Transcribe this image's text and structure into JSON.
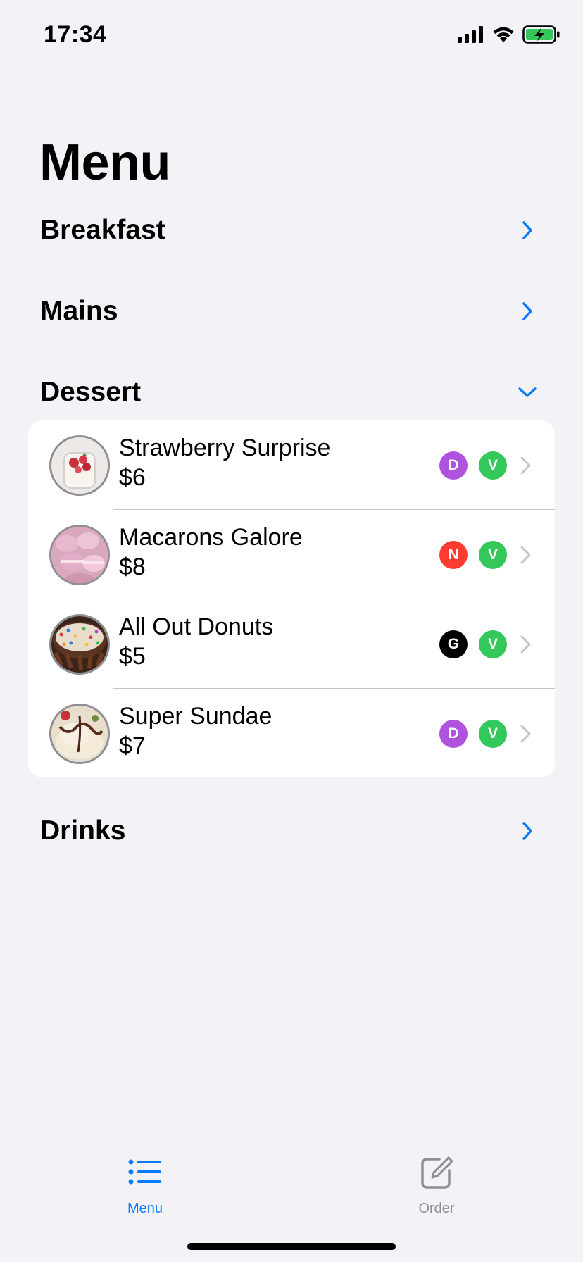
{
  "status_bar": {
    "time": "17:34"
  },
  "colors": {
    "accent": "#0A7AFF",
    "background": "#F2F2F7",
    "card": "#FFFFFF",
    "badge_D": "#AF52DE",
    "badge_V": "#34C759",
    "badge_N": "#FF3B30",
    "badge_G": "#000000",
    "inactive_tab": "#8E8E93"
  },
  "page": {
    "title": "Menu"
  },
  "sections": [
    {
      "label": "Breakfast",
      "state": "collapsed",
      "icon": "chevron-right-icon"
    },
    {
      "label": "Mains",
      "state": "collapsed",
      "icon": "chevron-right-icon"
    },
    {
      "label": "Dessert",
      "state": "expanded",
      "icon": "chevron-down-icon"
    },
    {
      "label": "Drinks",
      "state": "collapsed",
      "icon": "chevron-right-icon"
    }
  ],
  "dessert_items": [
    {
      "name": "Strawberry Surprise",
      "price": "$6",
      "badges": [
        "D",
        "V"
      ],
      "thumb": "strawberry-dessert-photo"
    },
    {
      "name": "Macarons Galore",
      "price": "$8",
      "badges": [
        "N",
        "V"
      ],
      "thumb": "macarons-photo"
    },
    {
      "name": "All Out Donuts",
      "price": "$5",
      "badges": [
        "G",
        "V"
      ],
      "thumb": "donuts-photo"
    },
    {
      "name": "Super Sundae",
      "price": "$7",
      "badges": [
        "D",
        "V"
      ],
      "thumb": "sundae-photo"
    }
  ],
  "tab_bar": {
    "tabs": [
      {
        "label": "Menu",
        "icon": "list-icon",
        "selected": true
      },
      {
        "label": "Order",
        "icon": "compose-icon",
        "selected": false
      }
    ]
  }
}
